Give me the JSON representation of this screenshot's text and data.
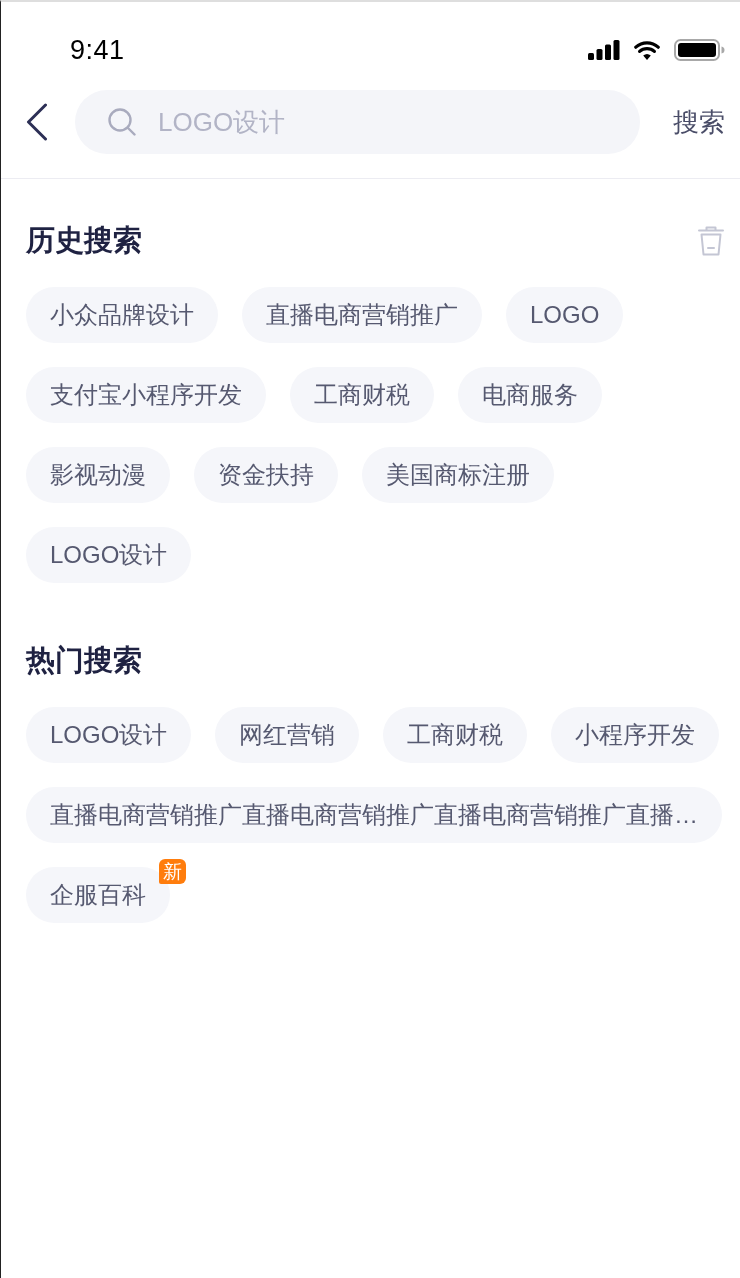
{
  "status_bar": {
    "time": "9:41"
  },
  "search_bar": {
    "placeholder": "LOGO设计",
    "button": "搜索"
  },
  "history": {
    "title": "历史搜索",
    "tags": [
      {
        "label": "小众品牌设计"
      },
      {
        "label": "直播电商营销推广"
      },
      {
        "label": "LOGO"
      },
      {
        "label": "支付宝小程序开发"
      },
      {
        "label": "工商财税"
      },
      {
        "label": "电商服务"
      },
      {
        "label": "影视动漫"
      },
      {
        "label": "资金扶持"
      },
      {
        "label": "美国商标注册"
      },
      {
        "label": "LOGO设计"
      }
    ]
  },
  "hot": {
    "title": "热门搜索",
    "tags": [
      {
        "label": "LOGO设计"
      },
      {
        "label": "网红营销"
      },
      {
        "label": "工商财税"
      },
      {
        "label": "小程序开发"
      },
      {
        "label": "直播电商营销推广直播电商营销推广直播电商营销推广直播…"
      },
      {
        "label": "企服百科",
        "badge": "新"
      }
    ]
  }
}
